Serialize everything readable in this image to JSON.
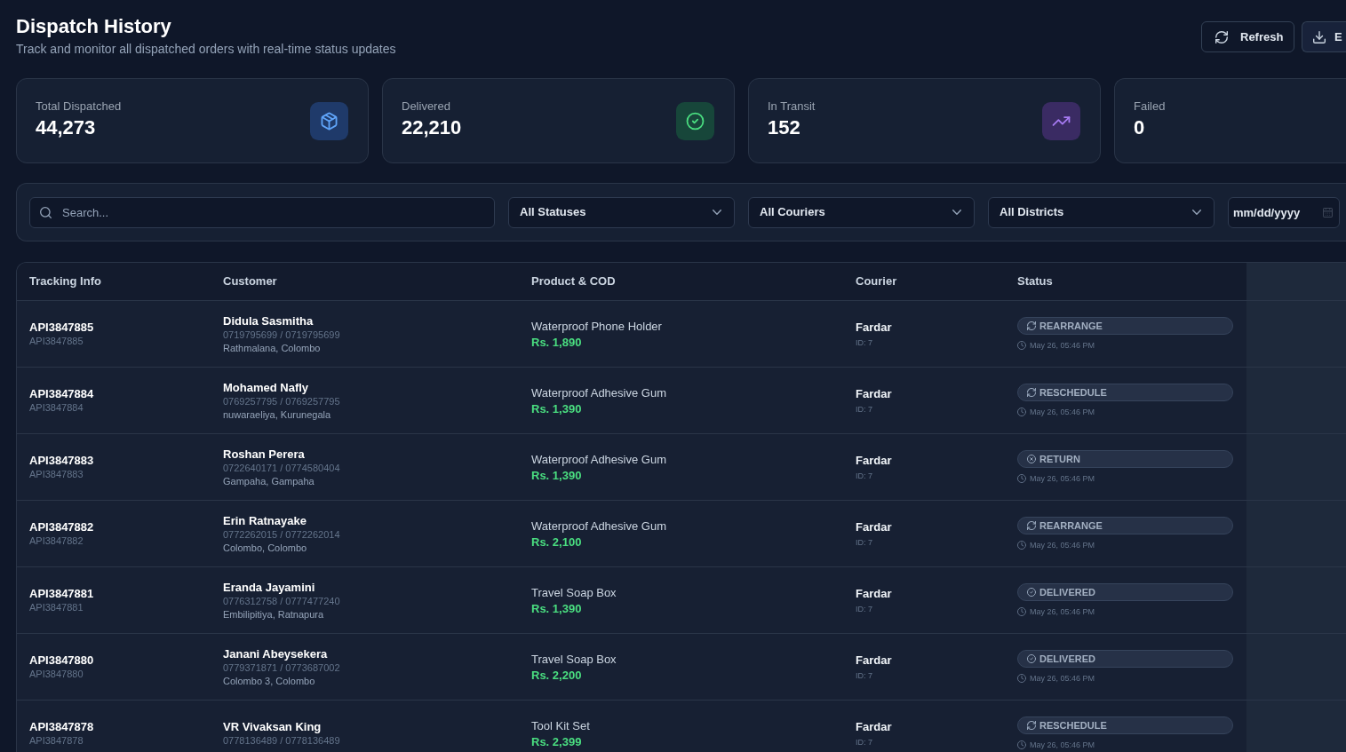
{
  "header": {
    "title": "Dispatch History",
    "subtitle": "Track and monitor all dispatched orders with real-time status updates"
  },
  "actions": [
    {
      "label": "Refresh",
      "kind": "refresh"
    },
    {
      "label": "E",
      "kind": "export"
    }
  ],
  "stats": [
    {
      "label": "Total Dispatched",
      "value": "44,273",
      "kind": "total"
    },
    {
      "label": "Delivered",
      "value": "22,210",
      "kind": "delivered"
    },
    {
      "label": "In Transit",
      "value": "152",
      "kind": "transit"
    },
    {
      "label": "Failed",
      "value": "0",
      "kind": "failed"
    }
  ],
  "filters": {
    "search": {
      "placeholder": "Search..."
    },
    "dropdowns": [
      "All Statuses",
      "All Couriers",
      "All Districts"
    ],
    "date": {
      "placeholder": "mm/dd/yyyy"
    }
  },
  "table": {
    "columns": [
      "Tracking Info",
      "Customer",
      "Product & COD",
      "Courier",
      "Status"
    ],
    "rows": [
      {
        "tracking": "API3847885",
        "reference": "API3847885",
        "customer": "Didula Sasmitha",
        "phones": "0719795699 / 0719795699",
        "location": "Rathmalana, Colombo",
        "product": "Waterproof Phone Holder",
        "cod": "Rs. 1,890",
        "courier": "Fardar",
        "courier_id": "ID: 7",
        "status": {
          "label": "REARRANGE",
          "kind": "rearrange"
        },
        "time": "May 26, 05:46 PM"
      },
      {
        "tracking": "API3847884",
        "reference": "API3847884",
        "customer": "Mohamed Nafly",
        "phones": "0769257795 / 0769257795",
        "location": "nuwaraeliya, Kurunegala",
        "product": "Waterproof Adhesive Gum",
        "cod": "Rs. 1,390",
        "courier": "Fardar",
        "courier_id": "ID: 7",
        "status": {
          "label": "RESCHEDULE",
          "kind": "reschedule"
        },
        "time": "May 26, 05:46 PM"
      },
      {
        "tracking": "API3847883",
        "reference": "API3847883",
        "customer": "Roshan Perera",
        "phones": "0722640171 / 0774580404",
        "location": "Gampaha, Gampaha",
        "product": "Waterproof Adhesive Gum",
        "cod": "Rs. 1,390",
        "courier": "Fardar",
        "courier_id": "ID: 7",
        "status": {
          "label": "RETURN",
          "kind": "return"
        },
        "time": "May 26, 05:46 PM"
      },
      {
        "tracking": "API3847882",
        "reference": "API3847882",
        "customer": "Erin Ratnayake",
        "phones": "0772262015 / 0772262014",
        "location": "Colombo, Colombo",
        "product": "Waterproof Adhesive Gum",
        "cod": "Rs. 2,100",
        "courier": "Fardar",
        "courier_id": "ID: 7",
        "status": {
          "label": "REARRANGE",
          "kind": "rearrange"
        },
        "time": "May 26, 05:46 PM"
      },
      {
        "tracking": "API3847881",
        "reference": "API3847881",
        "customer": "Eranda Jayamini",
        "phones": "0776312758 / 0777477240",
        "location": "Embilipitiya, Ratnapura",
        "product": "Travel Soap Box",
        "cod": "Rs. 1,390",
        "courier": "Fardar",
        "courier_id": "ID: 7",
        "status": {
          "label": "DELIVERED",
          "kind": "delivered"
        },
        "time": "May 26, 05:46 PM"
      },
      {
        "tracking": "API3847880",
        "reference": "API3847880",
        "customer": "Janani Abeysekera",
        "phones": "0779371871 / 0773687002",
        "location": "Colombo 3, Colombo",
        "product": "Travel Soap Box",
        "cod": "Rs. 2,200",
        "courier": "Fardar",
        "courier_id": "ID: 7",
        "status": {
          "label": "DELIVERED",
          "kind": "delivered"
        },
        "time": "May 26, 05:46 PM"
      },
      {
        "tracking": "API3847878",
        "reference": "API3847878",
        "customer": "VR Vivaksan King",
        "phones": "0778136489 / 0778136489",
        "product": "Tool Kit Set",
        "cod": "Rs. 2,399",
        "courier": "Fardar",
        "courier_id": "ID: 7",
        "status": {
          "label": "RESCHEDULE",
          "kind": "reschedule"
        },
        "time": "May 26, 05:46 PM"
      }
    ]
  }
}
